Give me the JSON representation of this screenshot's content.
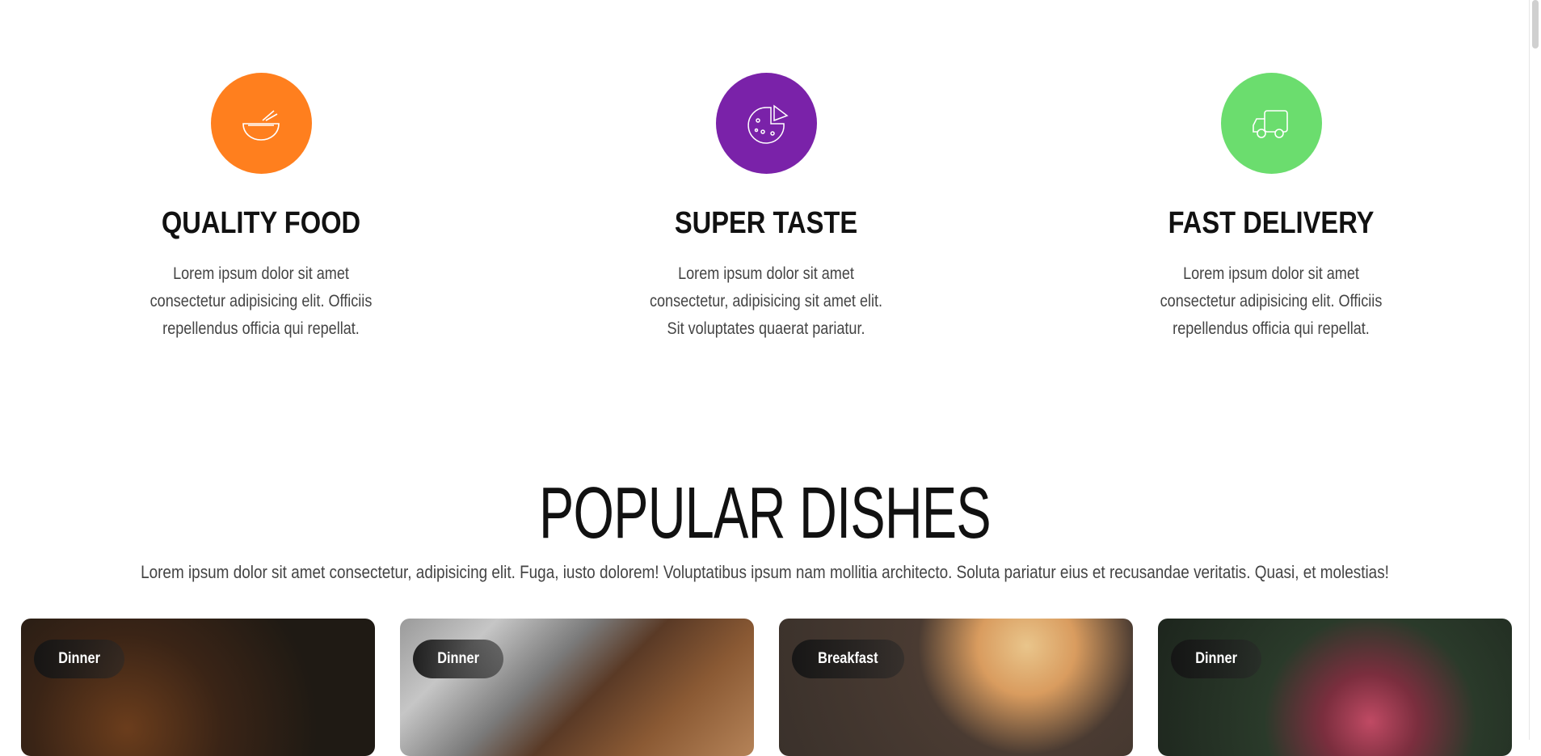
{
  "features": [
    {
      "title": "QUALITY FOOD",
      "text": "Lorem ipsum dolor sit amet consectetur adipisicing elit. Officiis repellendus officia qui repellat.",
      "icon": "bowl-icon",
      "color": "#FF7F1E"
    },
    {
      "title": "SUPER TASTE",
      "text": "Lorem ipsum dolor sit amet consectetur, adipisicing sit amet elit. Sit voluptates quaerat pariatur.",
      "icon": "pizza-icon",
      "color": "#7A22A9"
    },
    {
      "title": "FAST DELIVERY",
      "text": "Lorem ipsum dolor sit amet consectetur adipisicing elit. Officiis repellendus officia qui repellat.",
      "icon": "delivery-truck-icon",
      "color": "#6BDD6E"
    }
  ],
  "popular": {
    "heading": "POPULAR DISHES",
    "text": "Lorem ipsum dolor sit amet consectetur, adipisicing elit. Fuga, iusto dolorem! Voluptatibus ipsum nam mollitia architecto. Soluta pariatur eius et recusandae veritatis. Quasi, et molestias!"
  },
  "dishes": [
    {
      "category": "Dinner"
    },
    {
      "category": "Dinner"
    },
    {
      "category": "Breakfast"
    },
    {
      "category": "Dinner"
    }
  ]
}
